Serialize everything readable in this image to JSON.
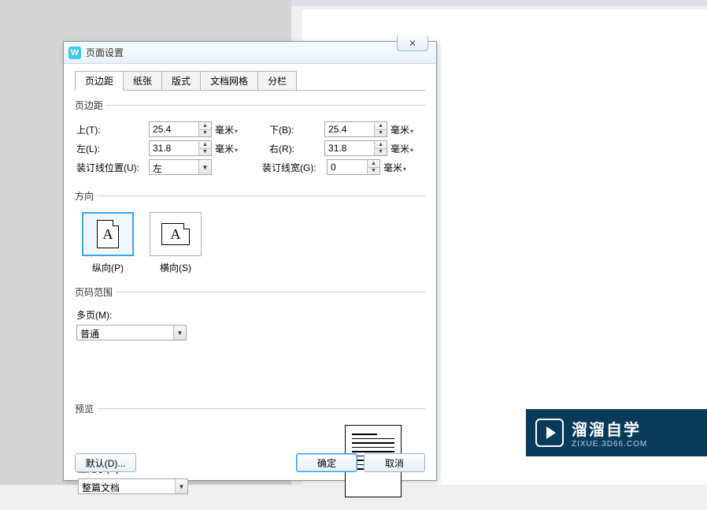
{
  "dialog": {
    "title": "页面设置"
  },
  "tabs": [
    "页边距",
    "纸张",
    "版式",
    "文档网格",
    "分栏"
  ],
  "margins": {
    "legend": "页边距",
    "top_label": "上(T):",
    "top_value": "25.4",
    "bottom_label": "下(B):",
    "bottom_value": "25.4",
    "left_label": "左(L):",
    "left_value": "31.8",
    "right_label": "右(R):",
    "right_value": "31.8",
    "unit": "毫米",
    "gutter_pos_label": "装订线位置(U):",
    "gutter_pos_value": "左",
    "gutter_width_label": "装订线宽(G):",
    "gutter_width_value": "0"
  },
  "orientation": {
    "legend": "方向",
    "portrait_label": "纵向(P)",
    "landscape_label": "横向(S)"
  },
  "page_range": {
    "legend": "页码范围",
    "multi_label": "多页(M):",
    "multi_value": "普通"
  },
  "preview": {
    "legend": "预览",
    "apply_label": "应用于(Y):",
    "apply_value": "整篇文档"
  },
  "buttons": {
    "default": "默认(D)...",
    "ok": "确定",
    "cancel": "取消"
  },
  "watermark": {
    "big": "溜溜自学",
    "small": "ZIXUE.3D66.COM"
  }
}
